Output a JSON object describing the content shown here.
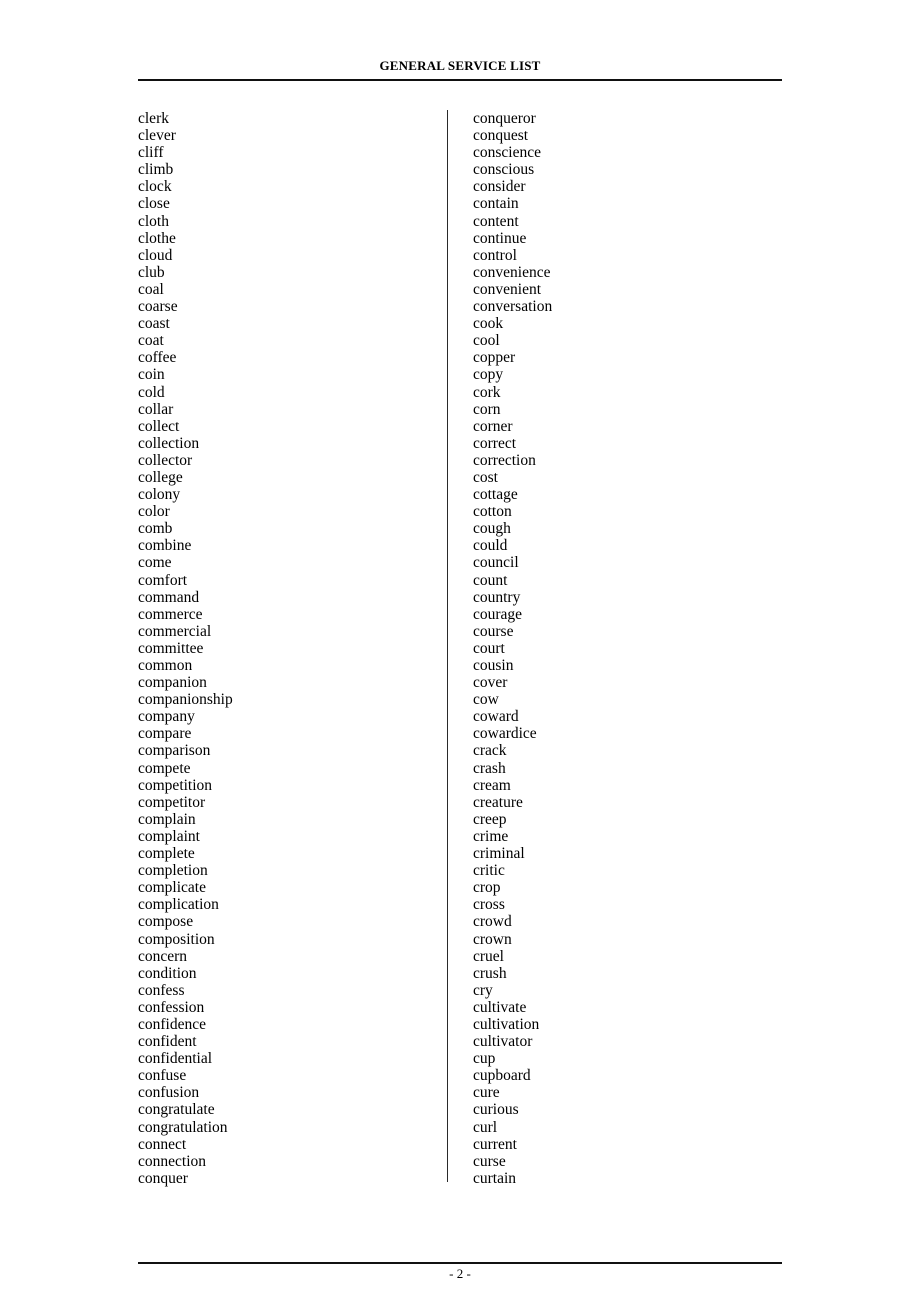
{
  "header": {
    "title": "GENERAL SERVICE LIST"
  },
  "footer": {
    "page_number": "- 2 -"
  },
  "columns": {
    "left": [
      "clerk",
      "clever",
      "cliff",
      "climb",
      "clock",
      "close",
      "cloth",
      "clothe",
      "cloud",
      "club",
      "coal",
      "coarse",
      "coast",
      "coat",
      "coffee",
      "coin",
      "cold",
      "collar",
      "collect",
      "collection",
      "collector",
      "college",
      "colony",
      "color",
      "comb",
      "combine",
      "come",
      "comfort",
      "command",
      "commerce",
      "commercial",
      "committee",
      "common",
      "companion",
      "companionship",
      "company",
      "compare",
      "comparison",
      "compete",
      "competition",
      "competitor",
      "complain",
      "complaint",
      "complete",
      "completion",
      "complicate",
      "complication",
      "compose",
      "composition",
      "concern",
      "condition",
      "confess",
      "confession",
      "confidence",
      "confident",
      "confidential",
      "confuse",
      "confusion",
      "congratulate",
      "congratulation",
      "connect",
      "connection",
      "conquer"
    ],
    "right": [
      "conqueror",
      "conquest",
      "conscience",
      "conscious",
      "consider",
      "contain",
      "content",
      "continue",
      "control",
      "convenience",
      "convenient",
      "conversation",
      "cook",
      "cool",
      "copper",
      "copy",
      "cork",
      "corn",
      "corner",
      "correct",
      "correction",
      "cost",
      "cottage",
      "cotton",
      "cough",
      "could",
      "council",
      "count",
      "country",
      "courage",
      "course",
      "court",
      "cousin",
      "cover",
      "cow",
      "coward",
      "cowardice",
      "crack",
      "crash",
      "cream",
      "creature",
      "creep",
      "crime",
      "criminal",
      "critic",
      "crop",
      "cross",
      "crowd",
      "crown",
      "cruel",
      "crush",
      "cry",
      "cultivate",
      "cultivation",
      "cultivator",
      "cup",
      "cupboard",
      "cure",
      "curious",
      "curl",
      "current",
      "curse",
      "curtain"
    ]
  }
}
